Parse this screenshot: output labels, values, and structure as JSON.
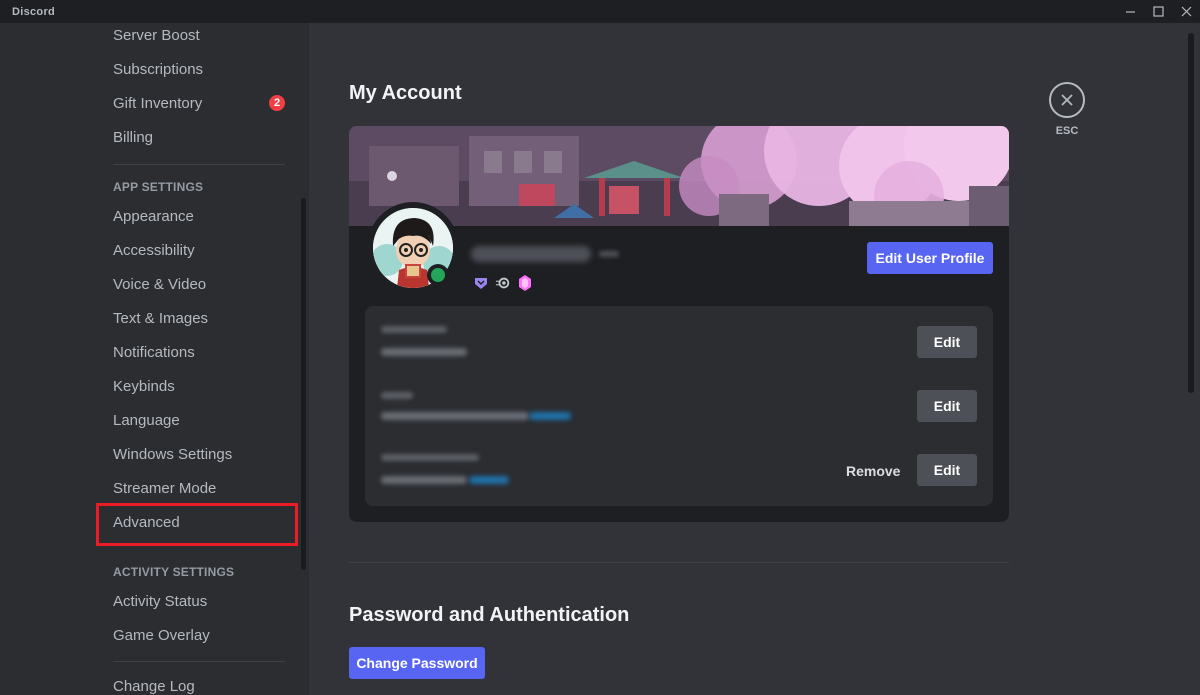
{
  "titlebar": {
    "app_name": "Discord"
  },
  "sidebar": {
    "user_settings_items": [
      {
        "label": "Server Boost"
      },
      {
        "label": "Subscriptions"
      },
      {
        "label": "Gift Inventory",
        "badge": "2"
      },
      {
        "label": "Billing"
      }
    ],
    "app_settings_header": "APP SETTINGS",
    "app_settings_items": [
      {
        "label": "Appearance"
      },
      {
        "label": "Accessibility"
      },
      {
        "label": "Voice & Video"
      },
      {
        "label": "Text & Images"
      },
      {
        "label": "Notifications"
      },
      {
        "label": "Keybinds"
      },
      {
        "label": "Language"
      },
      {
        "label": "Windows Settings"
      },
      {
        "label": "Streamer Mode"
      },
      {
        "label": "Advanced"
      }
    ],
    "activity_settings_header": "ACTIVITY SETTINGS",
    "activity_settings_items": [
      {
        "label": "Activity Status"
      },
      {
        "label": "Game Overlay"
      }
    ],
    "bottom_items": [
      {
        "label": "Change Log"
      }
    ]
  },
  "main": {
    "title": "My Account",
    "esc_label": "ESC",
    "edit_profile_label": "Edit User Profile",
    "edit_label": "Edit",
    "remove_label": "Remove",
    "password_section_title": "Password and Authentication",
    "change_password_label": "Change Password"
  },
  "colors": {
    "accent": "#5865f2",
    "online": "#23a55a",
    "badge_red": "#f23f43",
    "highlight": "#ed1c24"
  }
}
